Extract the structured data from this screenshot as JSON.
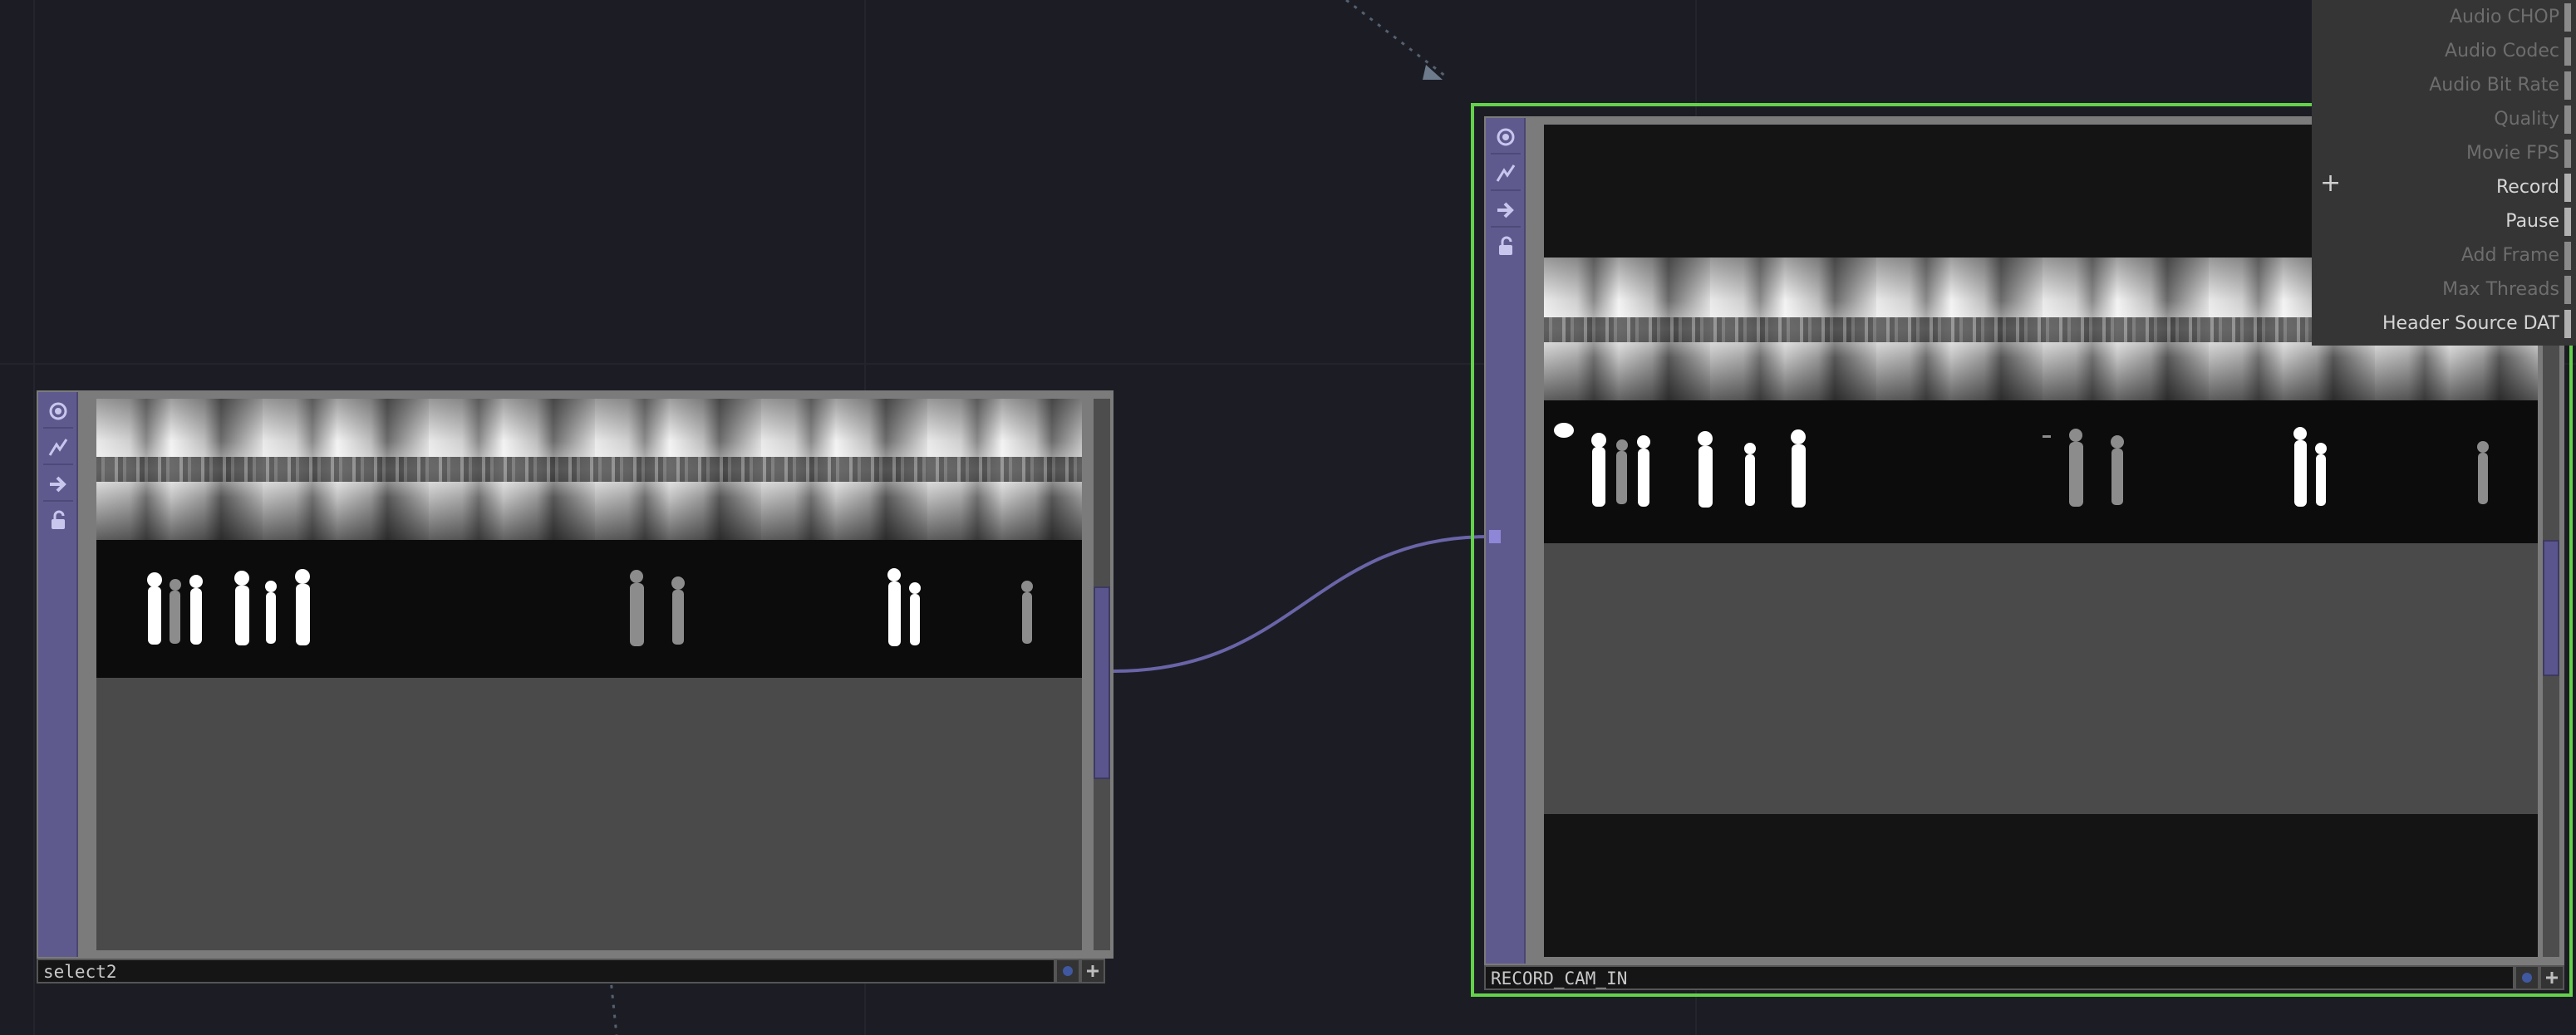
{
  "nodes": {
    "left": {
      "name": "select2"
    },
    "right": {
      "name": "RECORD_CAM_IN"
    }
  },
  "parameters": {
    "rows": [
      {
        "label": "Audio CHOP",
        "state": "dim"
      },
      {
        "label": "Audio Codec",
        "state": "dim"
      },
      {
        "label": "Audio Bit Rate",
        "state": "dim"
      },
      {
        "label": "Quality",
        "state": "dim"
      },
      {
        "label": "Movie FPS",
        "state": "dim"
      },
      {
        "label": "Record",
        "state": "lit"
      },
      {
        "label": "Pause",
        "state": "lit"
      },
      {
        "label": "Add Frame",
        "state": "dim"
      },
      {
        "label": "Max Threads",
        "state": "dim"
      },
      {
        "label": "Header Source DAT",
        "state": "lit"
      }
    ]
  },
  "icons": {
    "sidebar": [
      "viewer-icon",
      "cook-icon",
      "export-icon",
      "lock-icon"
    ],
    "label": [
      "display-flag-icon",
      "bypass-plus-icon"
    ]
  },
  "colors": {
    "background": "#1c1d24",
    "selected_outline": "#64d24a",
    "wire": "#6a64a8",
    "node_sidebar": "#5f5a8e"
  }
}
